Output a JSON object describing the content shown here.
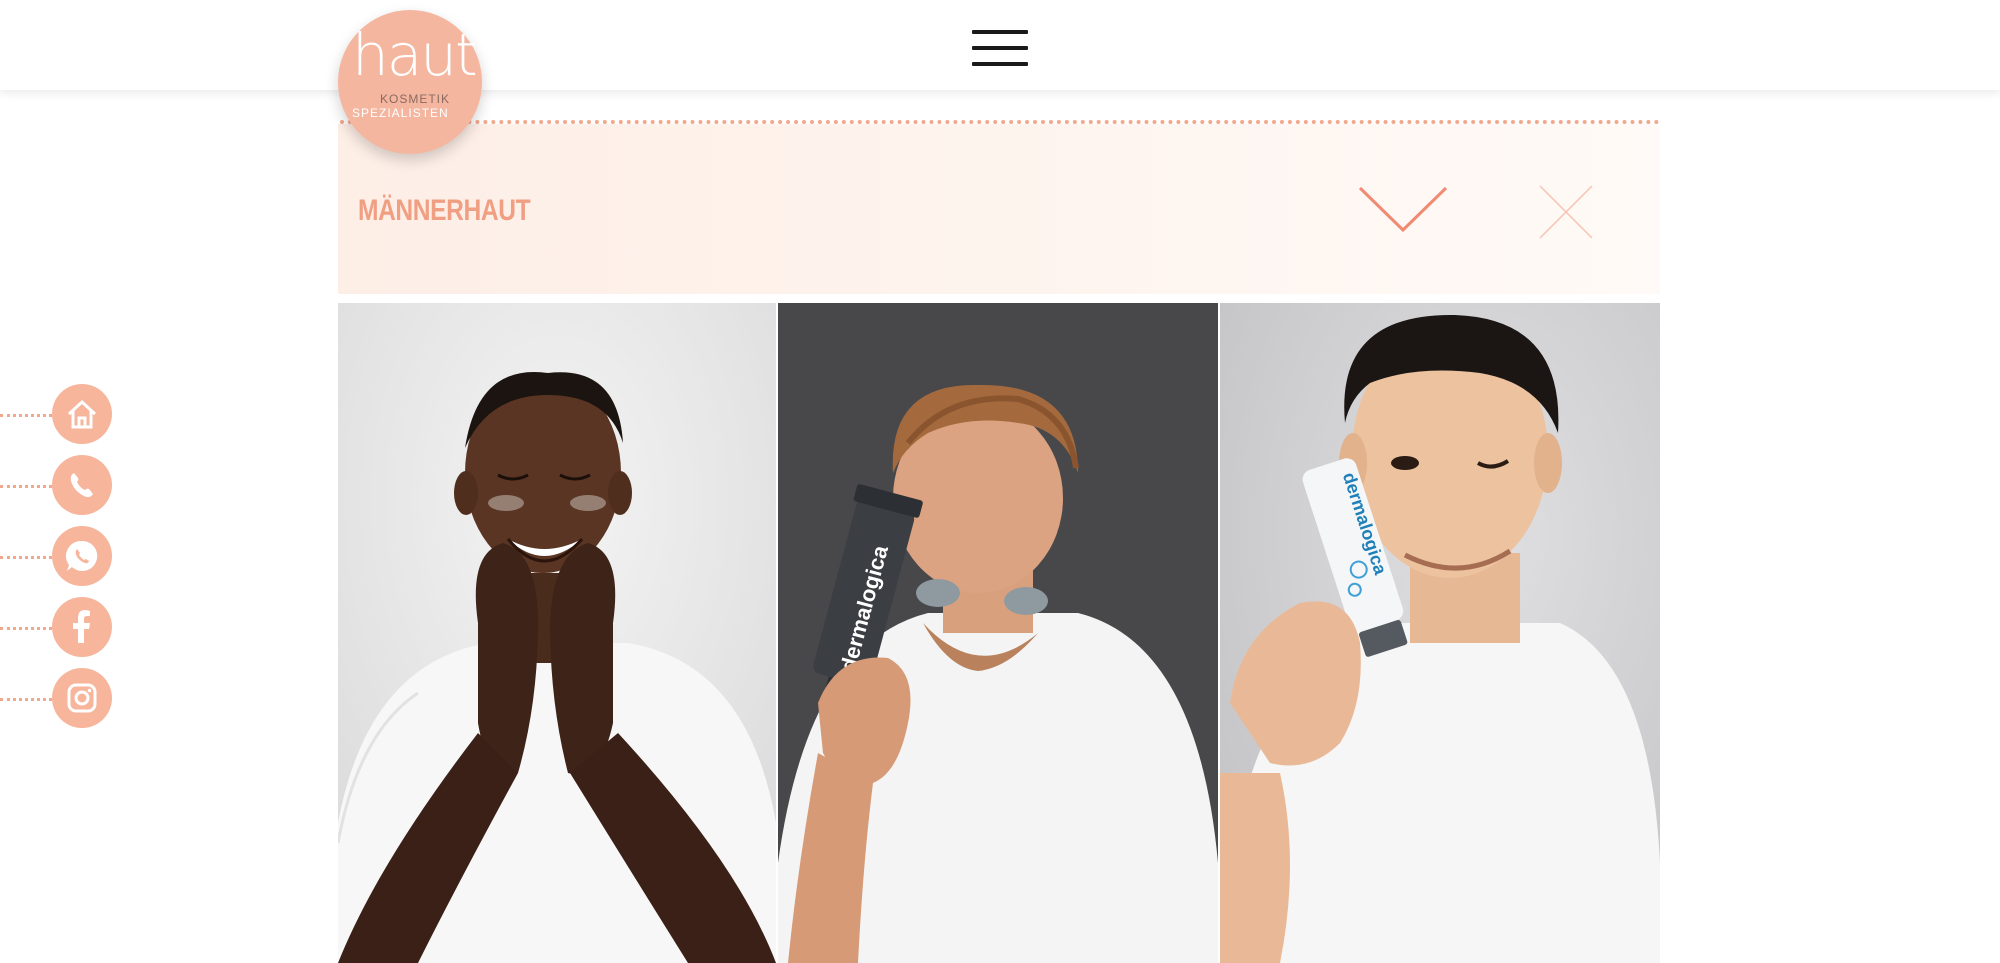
{
  "logo": {
    "word": "haut",
    "line1": "KOSMETIK",
    "line2": "SPEZIALISTEN"
  },
  "header": {
    "menu_icon": "hamburger-menu-icon"
  },
  "section": {
    "title": "MÄNNERHAUT",
    "expand_icon": "chevron-down-icon",
    "close_icon": "close-icon"
  },
  "gallery": {
    "photos": [
      {
        "name": "man-face-care-photo",
        "background": "#e9e9ea"
      },
      {
        "name": "man-with-dermalogica-cleanser-photo",
        "background": "#4a4a4c",
        "product_text": "dermalogica"
      },
      {
        "name": "man-with-dermalogica-cream-photo",
        "background": "#d3d3d5",
        "product_text": "dermalogica"
      }
    ]
  },
  "social": {
    "items": [
      {
        "name": "home-icon"
      },
      {
        "name": "phone-icon"
      },
      {
        "name": "whatsapp-icon"
      },
      {
        "name": "facebook-icon"
      },
      {
        "name": "instagram-icon"
      }
    ]
  },
  "colors": {
    "accent": "#f5b6a0",
    "title": "#f09f83",
    "banner": "#fdeee6"
  }
}
